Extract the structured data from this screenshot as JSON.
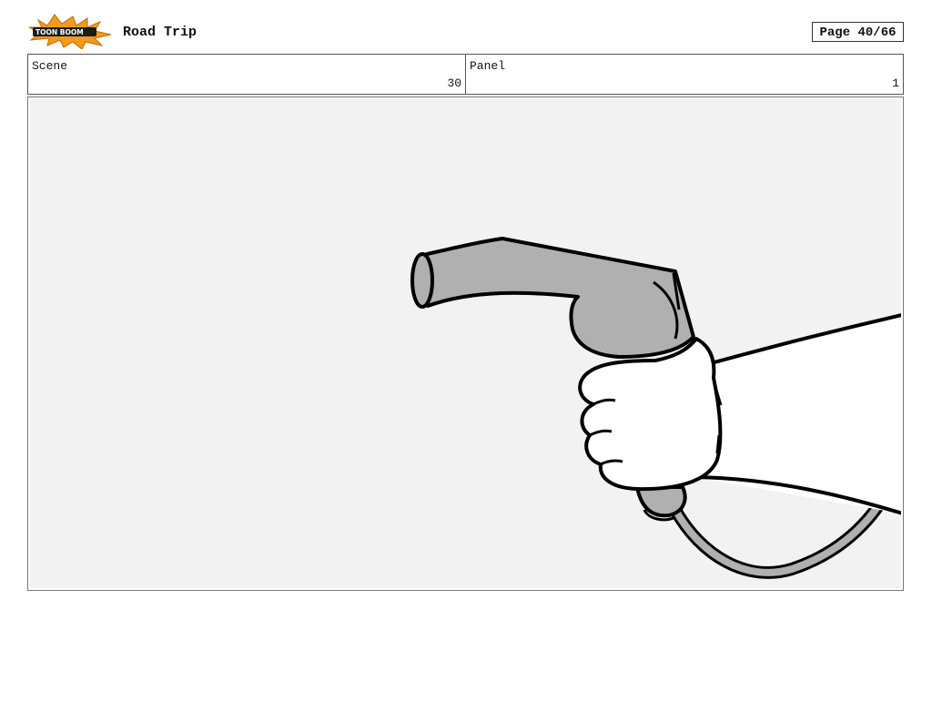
{
  "header": {
    "logo_text": "TOON BOOM",
    "project_title": "Road Trip",
    "page_label": "Page 40/66"
  },
  "meta": {
    "scene_label": "Scene",
    "scene_value": "30",
    "panel_label": "Panel",
    "panel_value": "1"
  },
  "panel": {
    "background_color": "#f2f2f2",
    "nozzle_color": "#b0b0b0",
    "line_color": "#000000"
  }
}
